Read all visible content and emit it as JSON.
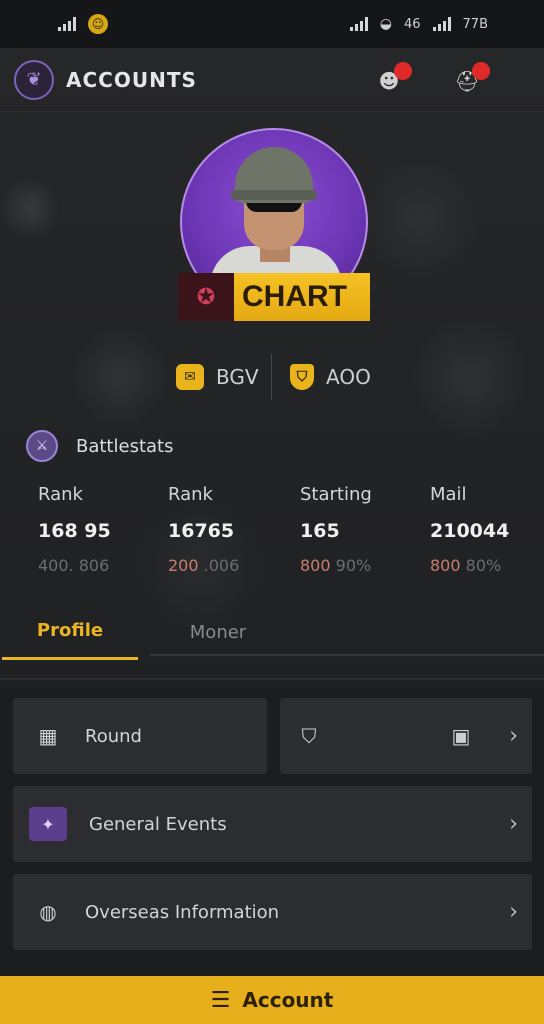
{
  "status_bar": {
    "left_signal": "᭶",
    "network_type": "46",
    "right_text": "77B"
  },
  "header": {
    "app_title": "ACCOUNTS",
    "logo_icon": "shield-emblem",
    "btn1_badge": "",
    "btn2_badge": ""
  },
  "profile": {
    "player_name": "CHART",
    "currency_1": "BGV",
    "currency_2": "AOO"
  },
  "stats": {
    "title": "Battlestats",
    "columns": [
      {
        "label": "Rank",
        "value": "168 95",
        "sub_hi": "",
        "sub": "400. 806"
      },
      {
        "label": "Rank",
        "value": "16765",
        "sub_hi": "200",
        "sub": ".006"
      },
      {
        "label": "Starting",
        "value": "165",
        "sub_hi": "800",
        "sub": "90%"
      },
      {
        "label": "Mail",
        "value": "210044",
        "sub_hi": "800",
        "sub": "80%"
      }
    ]
  },
  "tabs": {
    "active": "Profile",
    "inactive": "Moner"
  },
  "cards": {
    "card1_label": "Round",
    "card3_label": "General Events",
    "card4_label": "Overseas Information"
  },
  "bottom": {
    "label": "Account"
  },
  "colors": {
    "accent": "#e7af1b",
    "purple": "#7c62b8",
    "badge": "#e02a2a"
  }
}
